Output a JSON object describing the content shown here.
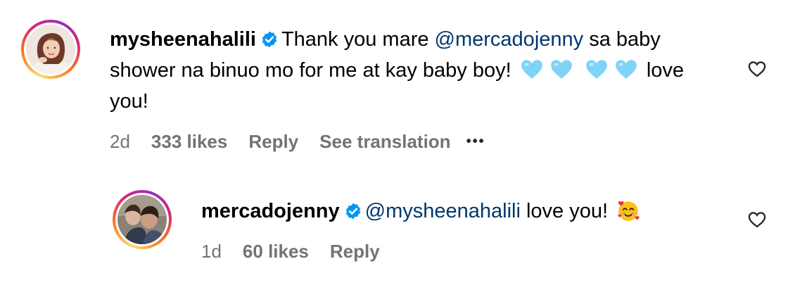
{
  "comments": [
    {
      "username": "mysheenahalili",
      "verified": true,
      "text_1": "Thank you mare ",
      "mention": "@mercadojenny",
      "text_2": " sa baby shower na binuo mo for me at kay baby boy! ",
      "text_3": " love you!",
      "emojis": [
        "light-blue-heart-emoji",
        "light-blue-heart-emoji",
        "light-blue-heart-emoji",
        "light-blue-heart-emoji"
      ],
      "time": "2d",
      "likes": "333 likes",
      "reply": "Reply",
      "see_translation": "See translation",
      "more": "•••",
      "like_icon": "heart-outline-icon"
    },
    {
      "username": "mercadojenny",
      "verified": true,
      "mention": "@mysheenahalili",
      "text_1": " love you! ",
      "emojis": [
        "smiling-face-with-hearts-emoji"
      ],
      "time": "1d",
      "likes": "60 likes",
      "reply": "Reply",
      "like_icon": "heart-outline-icon"
    }
  ],
  "colors": {
    "mention": "#00376b",
    "meta": "#737373",
    "verified": "#0095f6",
    "heart_emoji": "#7fd3f7"
  }
}
